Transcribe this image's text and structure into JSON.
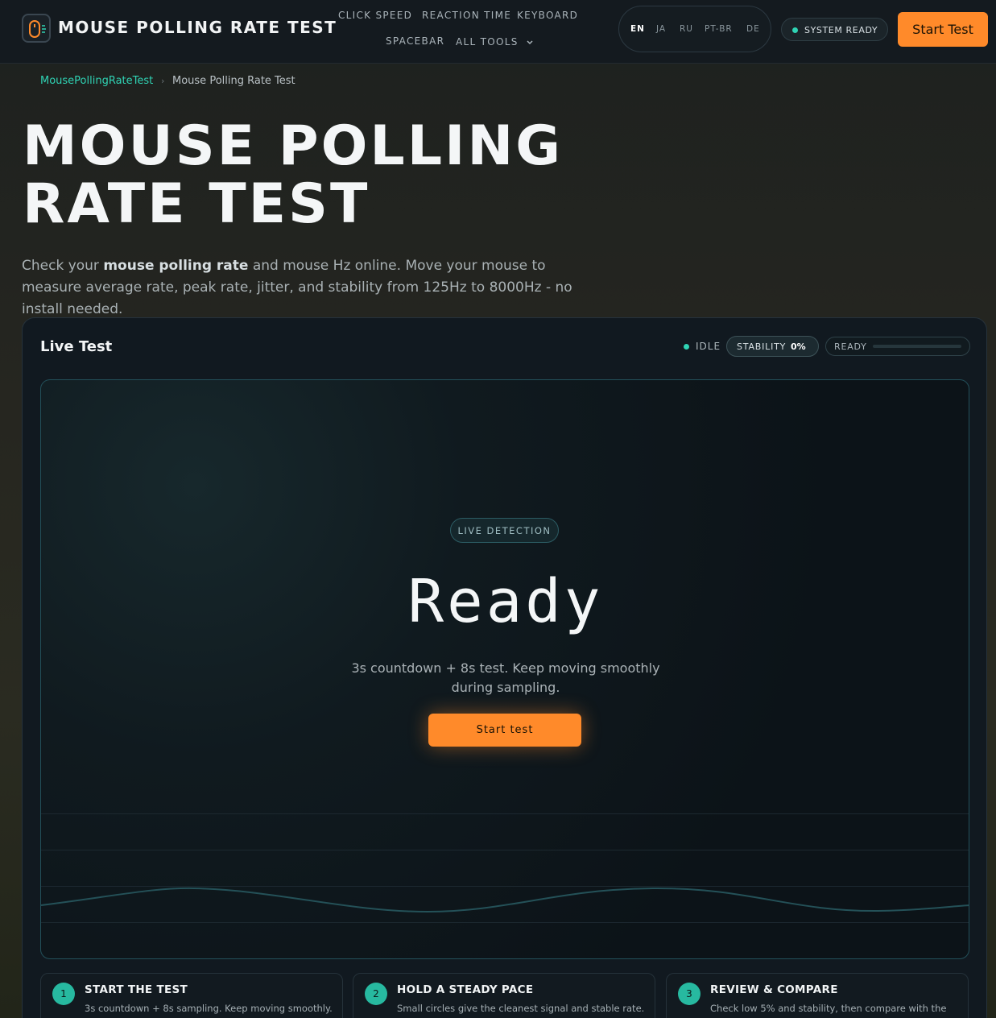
{
  "header": {
    "brand": "MOUSE POLLING RATE TEST",
    "nav": {
      "click_speed": "CLICK SPEED",
      "reaction_time": "REACTION TIME",
      "keyboard": "KEYBOARD",
      "spacebar": "SPACEBAR",
      "all_tools": "ALL TOOLS"
    },
    "languages": [
      "EN",
      "JA",
      "RU",
      "PT-BR",
      "DE"
    ],
    "active_language": "EN",
    "system_status": "SYSTEM READY",
    "start_button": "Start Test"
  },
  "breadcrumb": {
    "home": "MousePollingRateTest",
    "separator": "›",
    "current": "Mouse Polling Rate Test"
  },
  "hero": {
    "title": "MOUSE POLLING RATE TEST",
    "desc_pre": "Check your ",
    "desc_bold": "mouse polling rate",
    "desc_post": " and mouse Hz online. Move your mouse to measure average rate, peak rate, jitter, and stability from 125Hz to 8000Hz - no install needed."
  },
  "panel": {
    "title": "Live Test",
    "status": "IDLE",
    "stability_label": "STABILITY",
    "stability_value": "0%",
    "ready_label": "READY",
    "ready_progress": 0,
    "live_detection": "LIVE DETECTION",
    "state_text": "Ready",
    "instructions": "3s countdown + 8s test. Keep moving smoothly during sampling.",
    "start_button": "Start test"
  },
  "steps": [
    {
      "num": "1",
      "title": "START THE TEST",
      "desc": "3s countdown + 8s sampling. Keep moving smoothly."
    },
    {
      "num": "2",
      "title": "HOLD A STEADY PACE",
      "desc": "Small circles give the cleanest signal and stable rate."
    },
    {
      "num": "3",
      "title": "REVIEW & COMPARE",
      "desc": "Check low 5% and stability, then compare with the"
    }
  ],
  "colors": {
    "accent_orange": "#ff8a2a",
    "accent_teal": "#2fd3b4"
  },
  "icons": {
    "logo": "mouse-icon",
    "chevron": "chevron-down-icon"
  }
}
